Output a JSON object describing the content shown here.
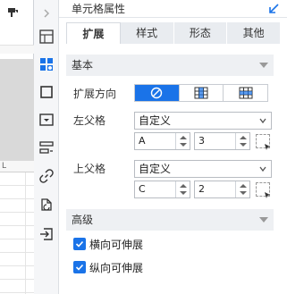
{
  "panel": {
    "title": "单元格属性",
    "tabs": [
      {
        "label": "扩展",
        "active": true
      },
      {
        "label": "样式",
        "active": false
      },
      {
        "label": "形态",
        "active": false
      },
      {
        "label": "其他",
        "active": false
      }
    ]
  },
  "basic": {
    "section_title": "基本",
    "expand_direction_label": "扩展方向",
    "left_parent": {
      "label": "左父格",
      "mode": "自定义",
      "column": "A",
      "row": "3"
    },
    "top_parent": {
      "label": "上父格",
      "mode": "自定义",
      "column": "C",
      "row": "2"
    }
  },
  "advanced": {
    "section_title": "高级",
    "options": [
      {
        "label": "横向可伸展",
        "checked": true
      },
      {
        "label": "纵向可伸展",
        "checked": true
      }
    ]
  },
  "sheet": {
    "column_header_fragment": "L"
  },
  "colors": {
    "accent": "#1a73e8",
    "section_bg": "#eef0f3",
    "icon_blue": "#1a73e8"
  }
}
